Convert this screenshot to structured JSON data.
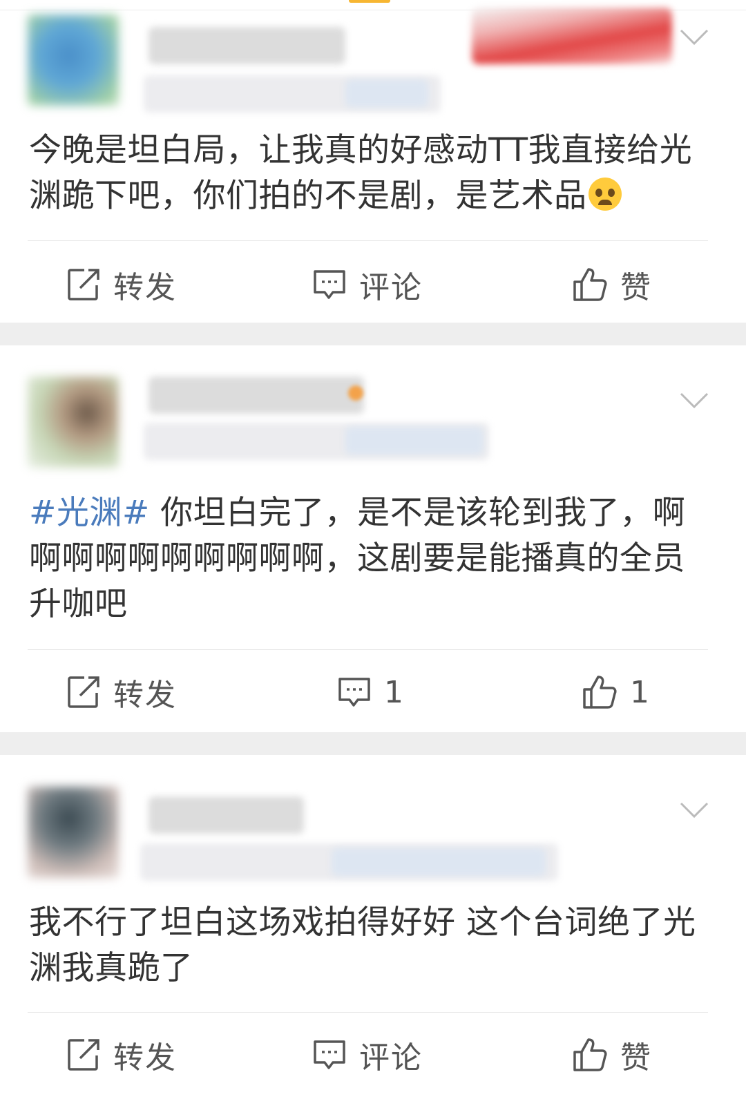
{
  "posts": [
    {
      "text": "今晚是坦白局，让我真的好感动TT我直接给光渊跪下吧，你们拍的不是剧，是艺术品",
      "emoji": "crying-face-emoji",
      "actions": {
        "repost_label": "转发",
        "comment_label": "评论",
        "like_label": "赞"
      }
    },
    {
      "hashtag": "#光渊#",
      "text": " 你坦白完了，是不是该轮到我了，啊啊啊啊啊啊啊啊啊啊，这剧要是能播真的全员升咖吧",
      "actions": {
        "repost_label": "转发",
        "comment_label": "1",
        "like_label": "1"
      }
    },
    {
      "text": "我不行了坦白这场戏拍得好好 这个台词绝了光渊我真跪了",
      "actions": {
        "repost_label": "转发",
        "comment_label": "评论",
        "like_label": "赞"
      }
    }
  ],
  "colors": {
    "text": "#333333",
    "hashtag": "#4a7bbc",
    "action_text": "#555555",
    "separator": "#eeeeee"
  }
}
